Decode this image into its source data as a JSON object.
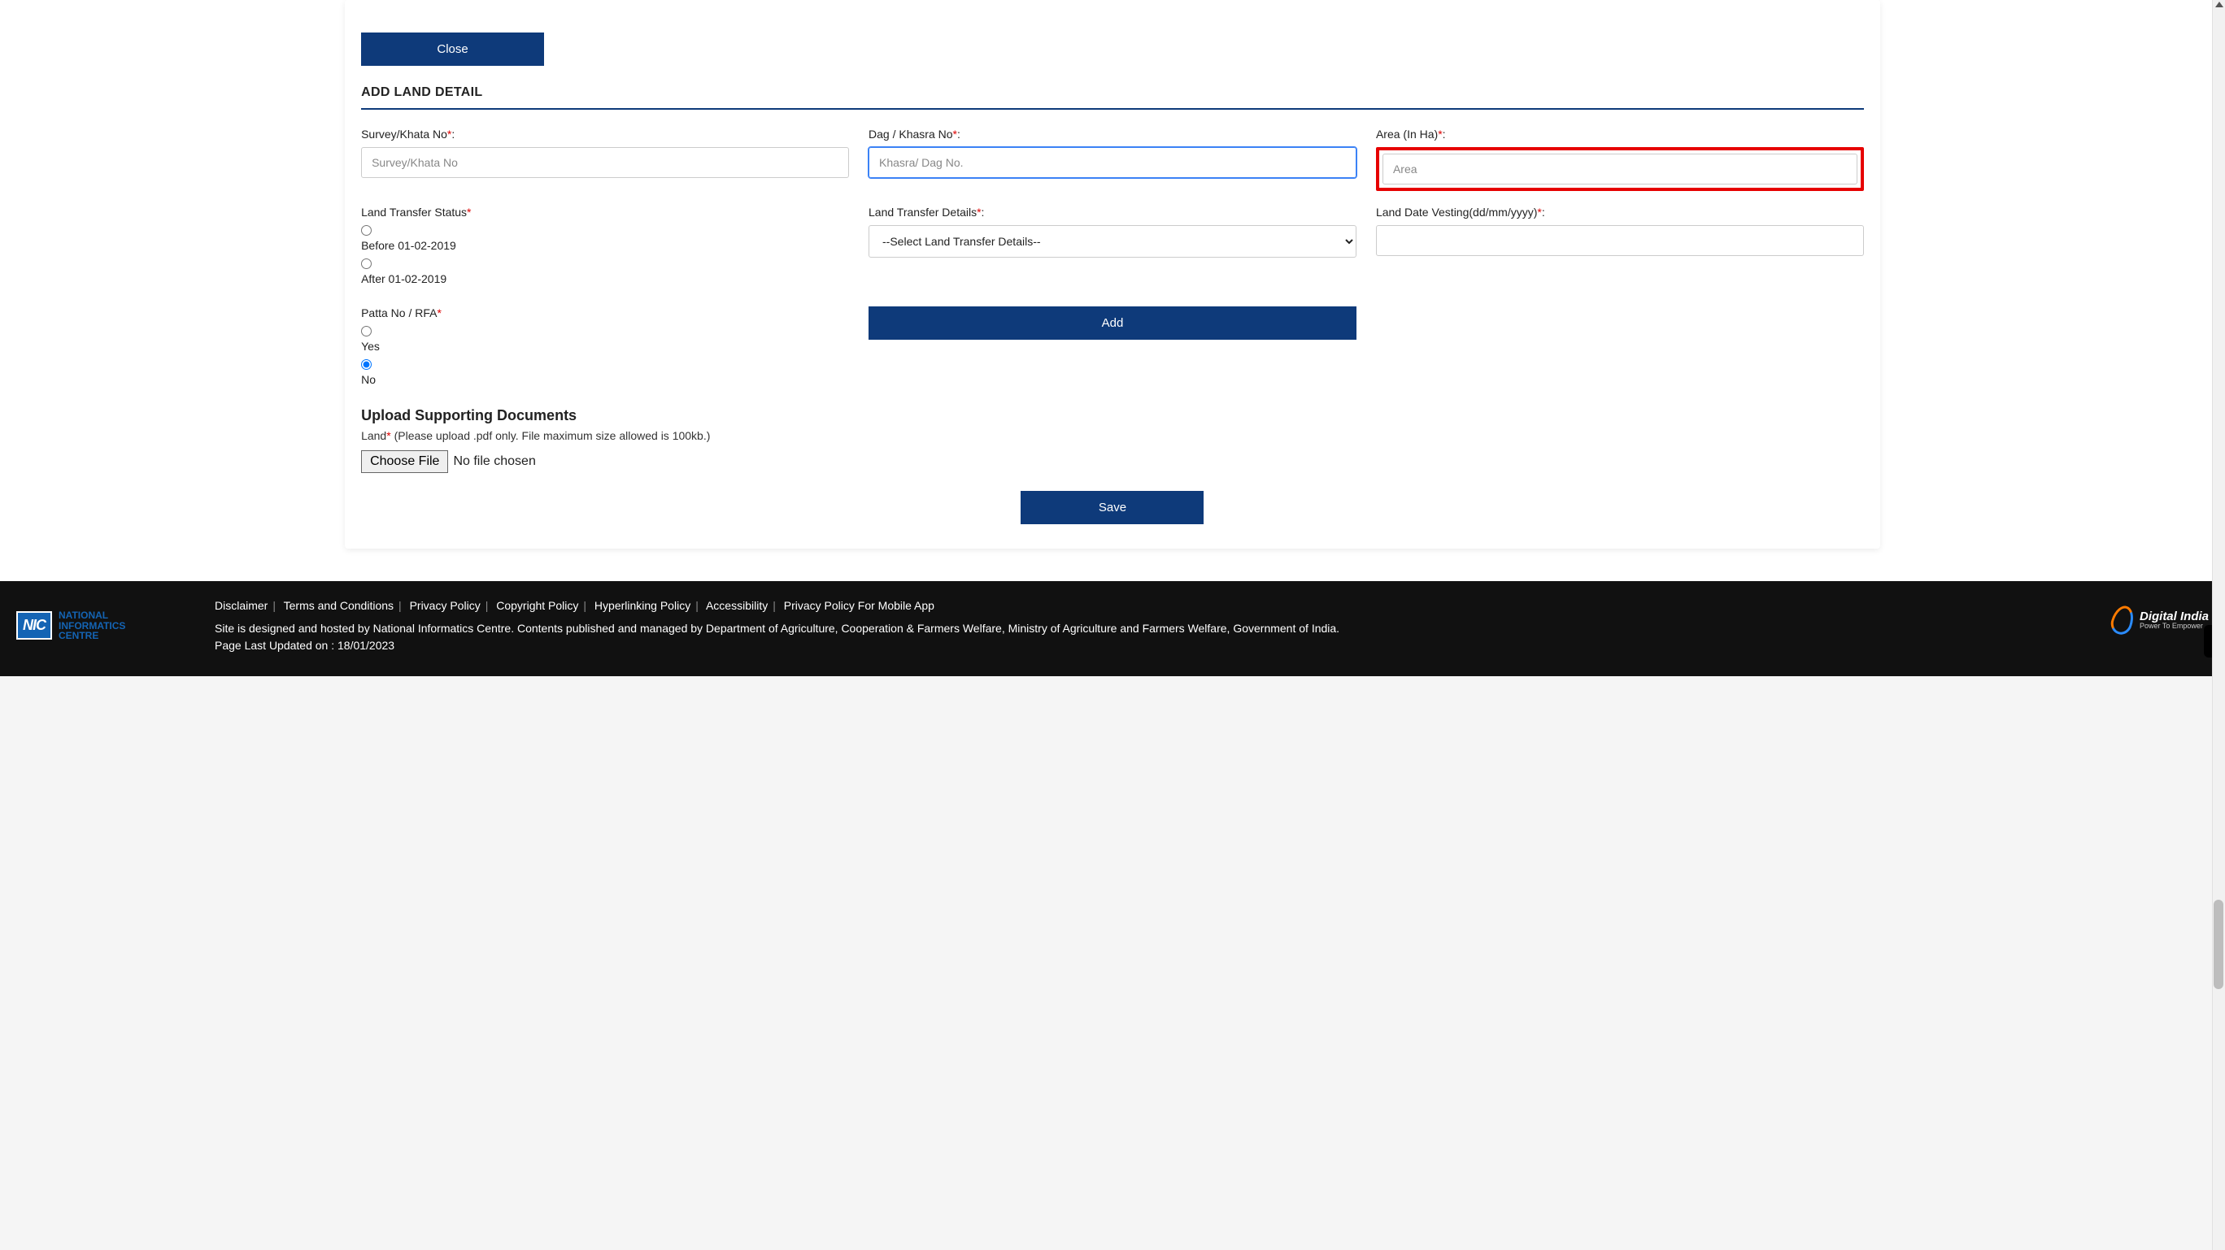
{
  "buttons": {
    "close": "Close",
    "add": "Add",
    "save": "Save",
    "choose_file": "Choose File",
    "no_file": "No file chosen"
  },
  "section_title": "ADD LAND DETAIL",
  "fields": {
    "survey": {
      "label": "Survey/Khata No",
      "placeholder": "Survey/Khata No"
    },
    "dag": {
      "label": "Dag / Khasra No",
      "placeholder": "Khasra/ Dag No."
    },
    "area": {
      "label": "Area (In Ha)",
      "placeholder": "Area"
    },
    "transfer_status": {
      "label": "Land Transfer Status",
      "options": {
        "before": "Before 01-02-2019",
        "after": "After 01-02-2019"
      }
    },
    "transfer_details": {
      "label": "Land Transfer Details",
      "placeholder": "--Select Land Transfer Details--"
    },
    "vesting": {
      "label": "Land Date Vesting(dd/mm/yyyy)"
    },
    "patta": {
      "label": "Patta No / RFA",
      "options": {
        "yes": "Yes",
        "no": "No"
      }
    }
  },
  "upload": {
    "title": "Upload Supporting Documents",
    "label": "Land",
    "hint": " (Please upload .pdf only. File maximum size allowed is 100kb.)"
  },
  "footer": {
    "links": [
      "Disclaimer",
      "Terms and Conditions",
      "Privacy Policy",
      "Copyright Policy",
      "Hyperlinking Policy",
      "Accessibility",
      "Privacy Policy For Mobile App"
    ],
    "text1": "Site is designed and hosted by National Informatics Centre. Contents published and managed by Department of Agriculture, Cooperation & Farmers Welfare, Ministry of Agriculture and Farmers Welfare, Government of India.",
    "updated_label": "Page Last Updated on : ",
    "updated_date": "18/01/2023",
    "nic": {
      "mark": "NIC",
      "line1": "NATIONAL",
      "line2": "INFORMATICS",
      "line3": "CENTRE"
    },
    "di": {
      "line1": "Digital India",
      "line2": "Power To Empower"
    }
  }
}
